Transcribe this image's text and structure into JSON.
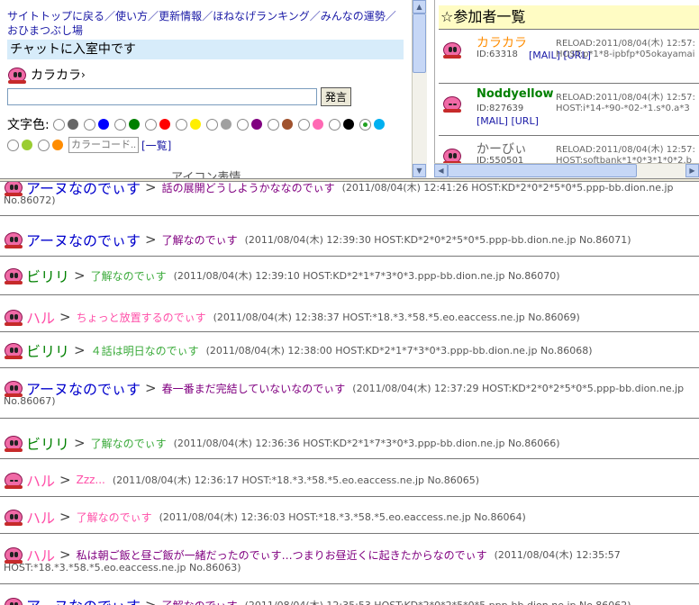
{
  "nav": {
    "links": [
      "サイトトップに戻る",
      "使い方",
      "更新情報",
      "ほねなげランキング",
      "みんなの運勢",
      "おひまつぶし場"
    ],
    "separator": "／"
  },
  "status": "チャットに入室中です",
  "user": {
    "name": "カラカラ",
    "suffix": "›"
  },
  "message": {
    "value": "",
    "button": "発言"
  },
  "colors": {
    "label": "文字色:",
    "options": [
      "#666666",
      "#0000ff",
      "#008000",
      "#ff0000",
      "#ffee00",
      "#a0a0a0",
      "#800080",
      "#a0522d",
      "#ff69b4",
      "#000000",
      "#00b0f0",
      "#9acd32",
      "#ff8c00"
    ],
    "selected_index": 10,
    "code_placeholder": "カラーコード...",
    "list_link": "[一覧]"
  },
  "cut_off_text": "アイコン表情",
  "participants": {
    "title": "☆参加者一覧",
    "members": [
      {
        "name": "カラカラ",
        "color": "#ff8c00",
        "id": "ID:63318",
        "links": "[MAIL] [URL]",
        "reload": "RELOAD:2011/08/04(木) 12:57:",
        "host": "HOST:p*1*8-ipbfp*05okayamai"
      },
      {
        "name": "Noddyellow",
        "color": "#008000",
        "id": "ID:827639",
        "links": "[MAIL] [URL]",
        "reload": "RELOAD:2011/08/04(木) 12:57:",
        "host": "HOST:i*14-*90-*02-*1.s*0.a*3"
      },
      {
        "name": "かーびぃ",
        "color": "#666666",
        "id": "ID:550501",
        "links": "",
        "reload": "RELOAD:2011/08/04(木) 12:57:",
        "host": "HOST:softbank*1*0*3*1*0*2.b"
      }
    ]
  },
  "chat": [
    {
      "name": "アーヌなのでぃす",
      "name_color": "#0000cc",
      "text": "話の展開どうしようかななのでぃす",
      "text_color": "#800080",
      "meta": "(2011/08/04(木) 12:41:26 HOST:KD*2*0*2*5*0*5.ppp-bb.dion.ne.jp",
      "meta2": "No.86072)"
    },
    {
      "name": "アーヌなのでぃす",
      "name_color": "#0000cc",
      "text": "了解なのでぃす",
      "text_color": "#800080",
      "meta": "(2011/08/04(木) 12:39:30 HOST:KD*2*0*2*5*0*5.ppp-bb.dion.ne.jp No.86071)",
      "meta2": ""
    },
    {
      "name": "ビリリ",
      "name_color": "#008000",
      "text": "了解なのでぃす",
      "text_color": "#3aaa3a",
      "meta": "(2011/08/04(木) 12:39:10 HOST:KD*2*1*7*3*0*3.ppp-bb.dion.ne.jp No.86070)",
      "meta2": ""
    },
    {
      "name": "ハル",
      "name_color": "#ff4fa8",
      "text": "ちょっと放置するのでぃす",
      "text_color": "#ff4fa8",
      "meta": "(2011/08/04(木) 12:38:37 HOST:*18.*3.*58.*5.eo.eaccess.ne.jp No.86069)",
      "meta2": ""
    },
    {
      "name": "ビリリ",
      "name_color": "#008000",
      "text": "４話は明日なのでぃす",
      "text_color": "#3aaa3a",
      "meta": "(2011/08/04(木) 12:38:00 HOST:KD*2*1*7*3*0*3.ppp-bb.dion.ne.jp No.86068)",
      "meta2": ""
    },
    {
      "name": "アーヌなのでぃす",
      "name_color": "#0000cc",
      "text": "春一番まだ完結していないなのでぃす",
      "text_color": "#800080",
      "meta": "(2011/08/04(木) 12:37:29 HOST:KD*2*0*2*5*0*5.ppp-bb.dion.ne.jp",
      "meta2": "No.86067)"
    },
    {
      "name": "ビリリ",
      "name_color": "#008000",
      "text": "了解なのでぃす",
      "text_color": "#3aaa3a",
      "meta": "(2011/08/04(木) 12:36:36 HOST:KD*2*1*7*3*0*3.ppp-bb.dion.ne.jp No.86066)",
      "meta2": ""
    },
    {
      "name": "ハル",
      "name_color": "#ff4fa8",
      "text": "Zzz...",
      "text_color": "#ff4fa8",
      "meta": "(2011/08/04(木) 12:36:17 HOST:*18.*3.*58.*5.eo.eaccess.ne.jp No.86065)",
      "meta2": ""
    },
    {
      "name": "ハル",
      "name_color": "#ff4fa8",
      "text": "了解なのでぃす",
      "text_color": "#ff4fa8",
      "meta": "(2011/08/04(木) 12:36:03 HOST:*18.*3.*58.*5.eo.eaccess.ne.jp No.86064)",
      "meta2": ""
    },
    {
      "name": "ハル",
      "name_color": "#ff4fa8",
      "text": "私は朝ご飯と昼ご飯が一緒だったのでぃす…つまりお昼近くに起きたからなのでぃす",
      "text_color": "#800080",
      "meta": "(2011/08/04(木) 12:35:57",
      "meta2": "HOST:*18.*3.*58.*5.eo.eaccess.ne.jp No.86063)"
    },
    {
      "name": "アーヌなのでぃす",
      "name_color": "#0000cc",
      "text": "了解なのでぃす",
      "text_color": "#800080",
      "meta": "(2011/08/04(木) 12:35:53 HOST:KD*2*0*2*5*0*5.ppp-bb.dion.ne.jp No.86062)",
      "meta2": ""
    }
  ]
}
